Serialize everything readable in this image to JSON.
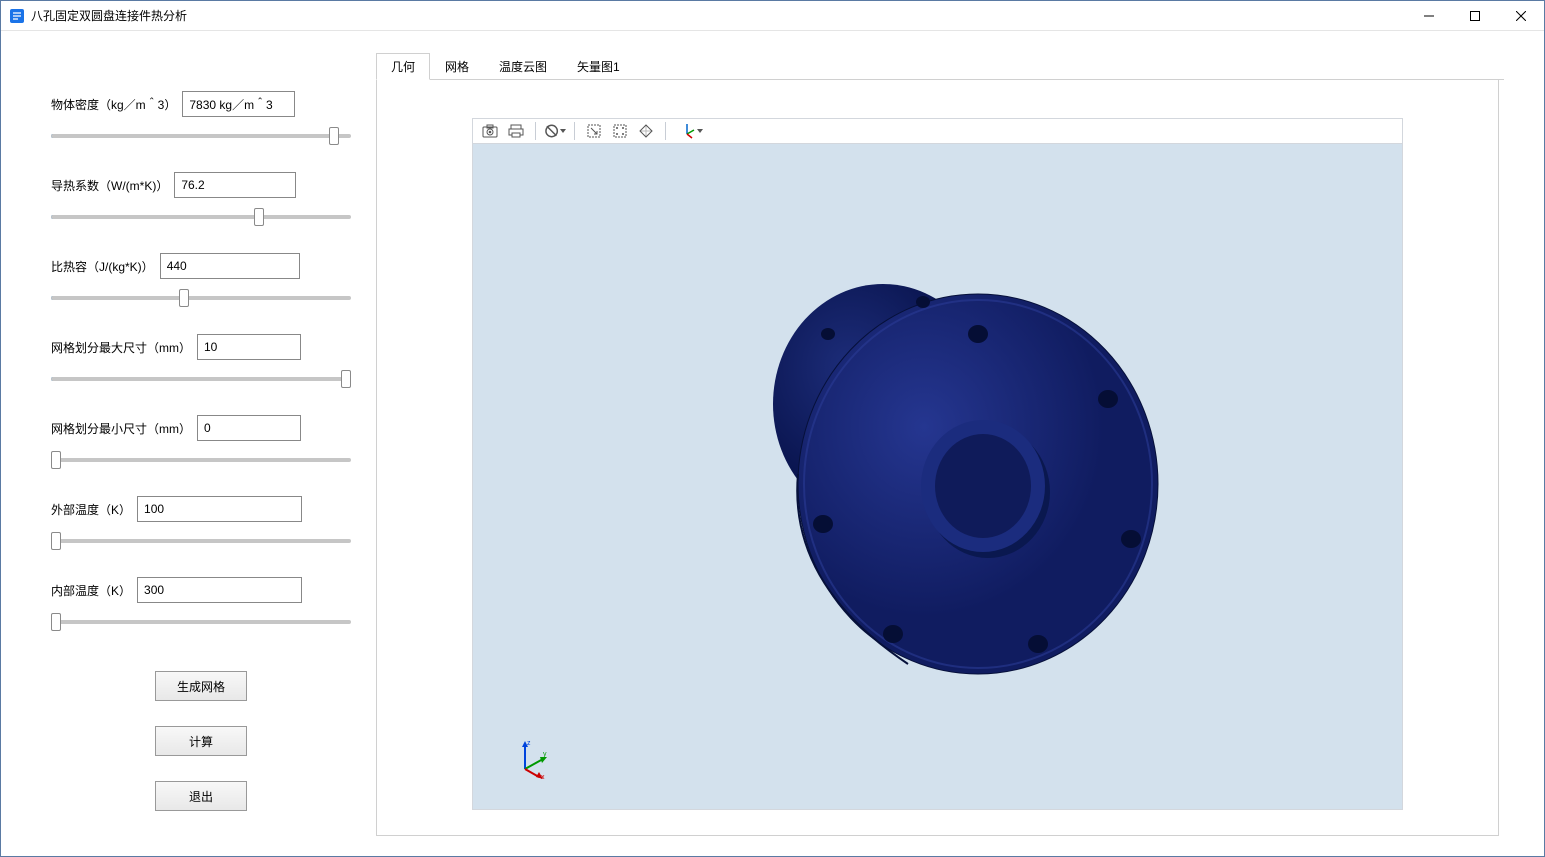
{
  "window": {
    "title": "八孔固定双圆盘连接件热分析"
  },
  "params": {
    "density": {
      "label": "物体密度（kg／m＾3）",
      "value": "7830 kg／m＾3",
      "fill": 96
    },
    "thermal_k": {
      "label": "导热系数（W/(m*K)）",
      "value": "76.2",
      "fill": 70
    },
    "heat_cap": {
      "label": "比热容（J/(kg*K)）",
      "value": "440",
      "fill": 44
    },
    "mesh_max": {
      "label": "网格划分最大尺寸（mm）",
      "value": "10",
      "fill": 100
    },
    "mesh_min": {
      "label": "网格划分最小尺寸（mm）",
      "value": "0",
      "fill": 0
    },
    "temp_out": {
      "label": "外部温度（K）",
      "value": "100",
      "fill": 0
    },
    "temp_in": {
      "label": "内部温度（K）",
      "value": "300",
      "fill": 0
    }
  },
  "buttons": {
    "generate_mesh": "生成网格",
    "calculate": "计算",
    "exit": "退出"
  },
  "tabs": {
    "geometry": "几何",
    "mesh": "网格",
    "temp_contour": "温度云图",
    "vector1": "矢量图1"
  },
  "toolbar_icons": {
    "screenshot": "screenshot-icon",
    "print": "print-icon",
    "reset": "reset-view-icon",
    "zoom_box": "zoom-box-icon",
    "zoom_extents": "zoom-extents-icon",
    "transparency": "transparency-icon",
    "axis_menu": "axis-menu-icon"
  },
  "axis": {
    "x": "x",
    "y": "y",
    "z": "z"
  }
}
